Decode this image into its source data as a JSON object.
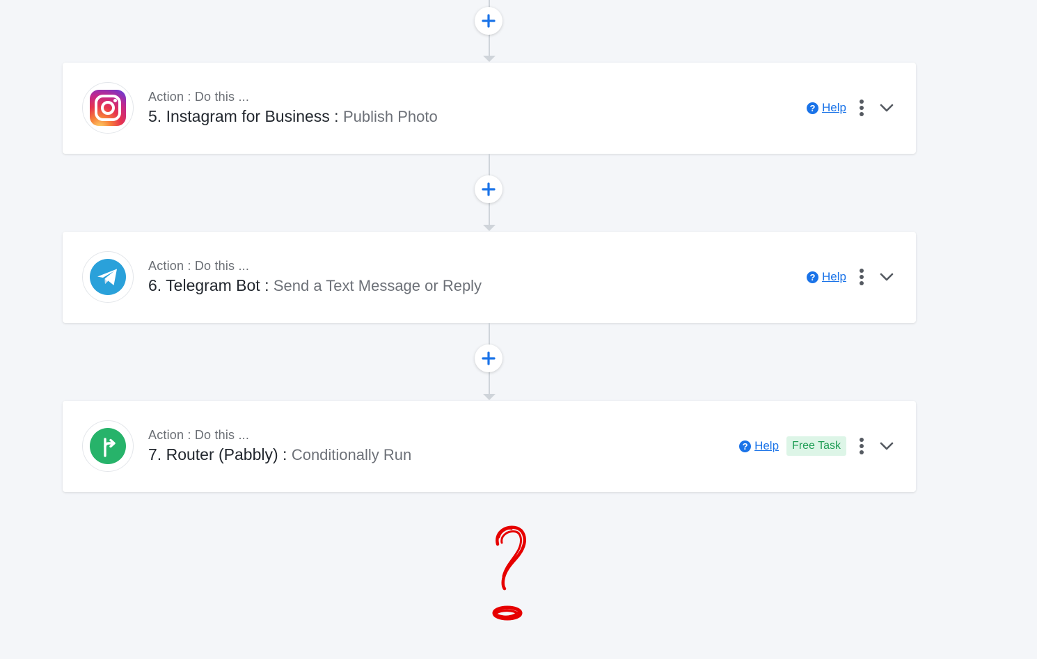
{
  "flow": {
    "add_step_icon": "plus-icon",
    "steps": [
      {
        "action_label": "Action : Do this ...",
        "number": "5.",
        "app_name": "Instagram for Business",
        "separator": " : ",
        "event": "Publish Photo",
        "icon": "instagram-icon",
        "help_label": "Help",
        "badge": ""
      },
      {
        "action_label": "Action : Do this ...",
        "number": "6.",
        "app_name": "Telegram Bot",
        "separator": " : ",
        "event": "Send a Text Message or Reply",
        "icon": "telegram-icon",
        "help_label": "Help",
        "badge": ""
      },
      {
        "action_label": "Action : Do this ...",
        "number": "7.",
        "app_name": "Router (Pabbly)",
        "separator": " : ",
        "event": "Conditionally Run",
        "icon": "router-icon",
        "help_label": "Help",
        "badge": "Free Task"
      }
    ]
  },
  "colors": {
    "accent": "#1a73e8",
    "router_green": "#27b36a",
    "telegram_blue": "#2aa1da",
    "free_task_bg": "#ddf5e7",
    "free_task_text": "#1f9d55",
    "annotation_red": "#e60000"
  }
}
